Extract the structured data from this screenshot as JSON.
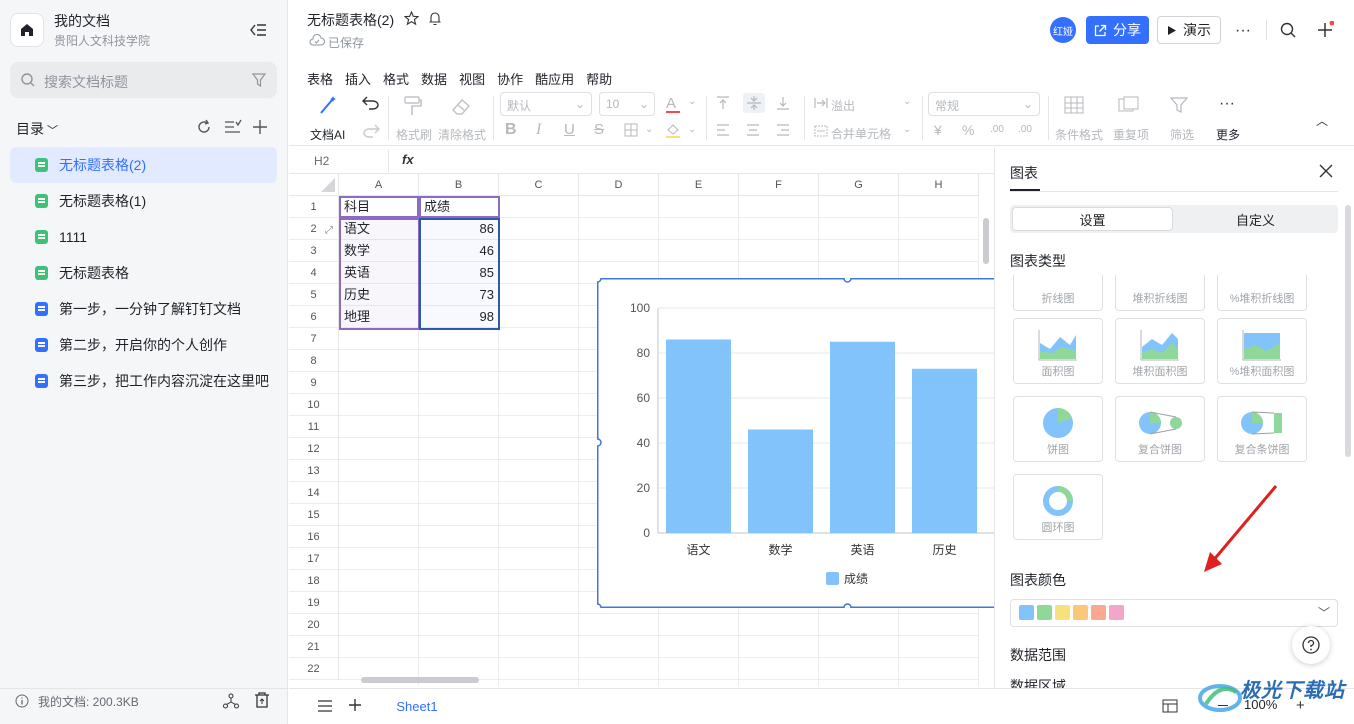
{
  "sidebar": {
    "workspace_title": "我的文档",
    "workspace_subtitle": "贵阳人文科技学院",
    "search_placeholder": "搜索文档标题",
    "toc_label": "目录",
    "files": [
      {
        "name": "无标题表格(2)",
        "type": "sheet",
        "active": true
      },
      {
        "name": "无标题表格(1)",
        "type": "sheet",
        "active": false
      },
      {
        "name": "1111",
        "type": "sheet",
        "active": false
      },
      {
        "name": "无标题表格",
        "type": "sheet",
        "active": false
      },
      {
        "name": "第一步，一分钟了解钉钉文档",
        "type": "doc",
        "active": false
      },
      {
        "name": "第二步，开启你的个人创作",
        "type": "doc",
        "active": false
      },
      {
        "name": "第三步，把工作内容沉淀在这里吧",
        "type": "doc",
        "active": false
      }
    ],
    "storage": "我的文档: 200.3KB"
  },
  "header": {
    "doc_title": "无标题表格(2)",
    "save_status": "已保存",
    "avatar_text": "红娅",
    "share_label": "分享",
    "present_label": "演示"
  },
  "menu": [
    "表格",
    "插入",
    "格式",
    "数据",
    "视图",
    "协作",
    "酷应用",
    "帮助"
  ],
  "toolbar": {
    "ai_label": "文档AI",
    "format_painter": "格式刷",
    "clear_format": "清除格式",
    "font_select": "默认",
    "size_select": "10",
    "overflow": "溢出",
    "merge_cells": "合并单元格",
    "number_format": "常规",
    "currency": "¥",
    "percent": "%",
    "conditional": "条件格式",
    "duplicates": "重复项",
    "filter": "筛选",
    "more": "更多"
  },
  "formula_bar": {
    "cell_ref": "H2",
    "fx": "fx"
  },
  "sheet": {
    "columns": [
      "A",
      "B",
      "C",
      "D",
      "E",
      "F",
      "G",
      "H"
    ],
    "rows": [
      "1",
      "2",
      "3",
      "4",
      "5",
      "6",
      "7",
      "8",
      "9",
      "10",
      "11",
      "12",
      "13",
      "14",
      "15",
      "16",
      "17",
      "18",
      "19",
      "20",
      "21",
      "22"
    ],
    "header_a": "科目",
    "header_b": "成绩",
    "data": [
      {
        "subject": "语文",
        "score": "86"
      },
      {
        "subject": "数学",
        "score": "46"
      },
      {
        "subject": "英语",
        "score": "85"
      },
      {
        "subject": "历史",
        "score": "73"
      },
      {
        "subject": "地理",
        "score": "98"
      }
    ],
    "tab_name": "Sheet1",
    "zoom": "100%"
  },
  "chart_data": {
    "type": "bar",
    "categories": [
      "语文",
      "数学",
      "英语",
      "历史"
    ],
    "series": [
      {
        "name": "成绩",
        "values": [
          86,
          46,
          85,
          73
        ]
      }
    ],
    "ylim": [
      0,
      100
    ],
    "yticks": [
      "0",
      "20",
      "40",
      "60",
      "80",
      "100"
    ],
    "legend": "bottom",
    "grid": true,
    "color": "#82c3fb"
  },
  "panel": {
    "title": "图表",
    "tab_settings": "设置",
    "tab_custom": "自定义",
    "chart_type_label": "图表类型",
    "chart_types": [
      "折线图",
      "堆积折线图",
      "%堆积折线图",
      "面积图",
      "堆积面积图",
      "%堆积面积图",
      "饼图",
      "复合饼图",
      "复合条饼图",
      "圆环图"
    ],
    "color_label": "图表颜色",
    "palette": [
      "#82c3fb",
      "#8fd89a",
      "#f8e07a",
      "#fbc77a",
      "#f8a98f",
      "#f3a6c8"
    ],
    "data_range_label": "数据范围",
    "data_area_label": "数据区域"
  },
  "watermark": "极光下载站"
}
